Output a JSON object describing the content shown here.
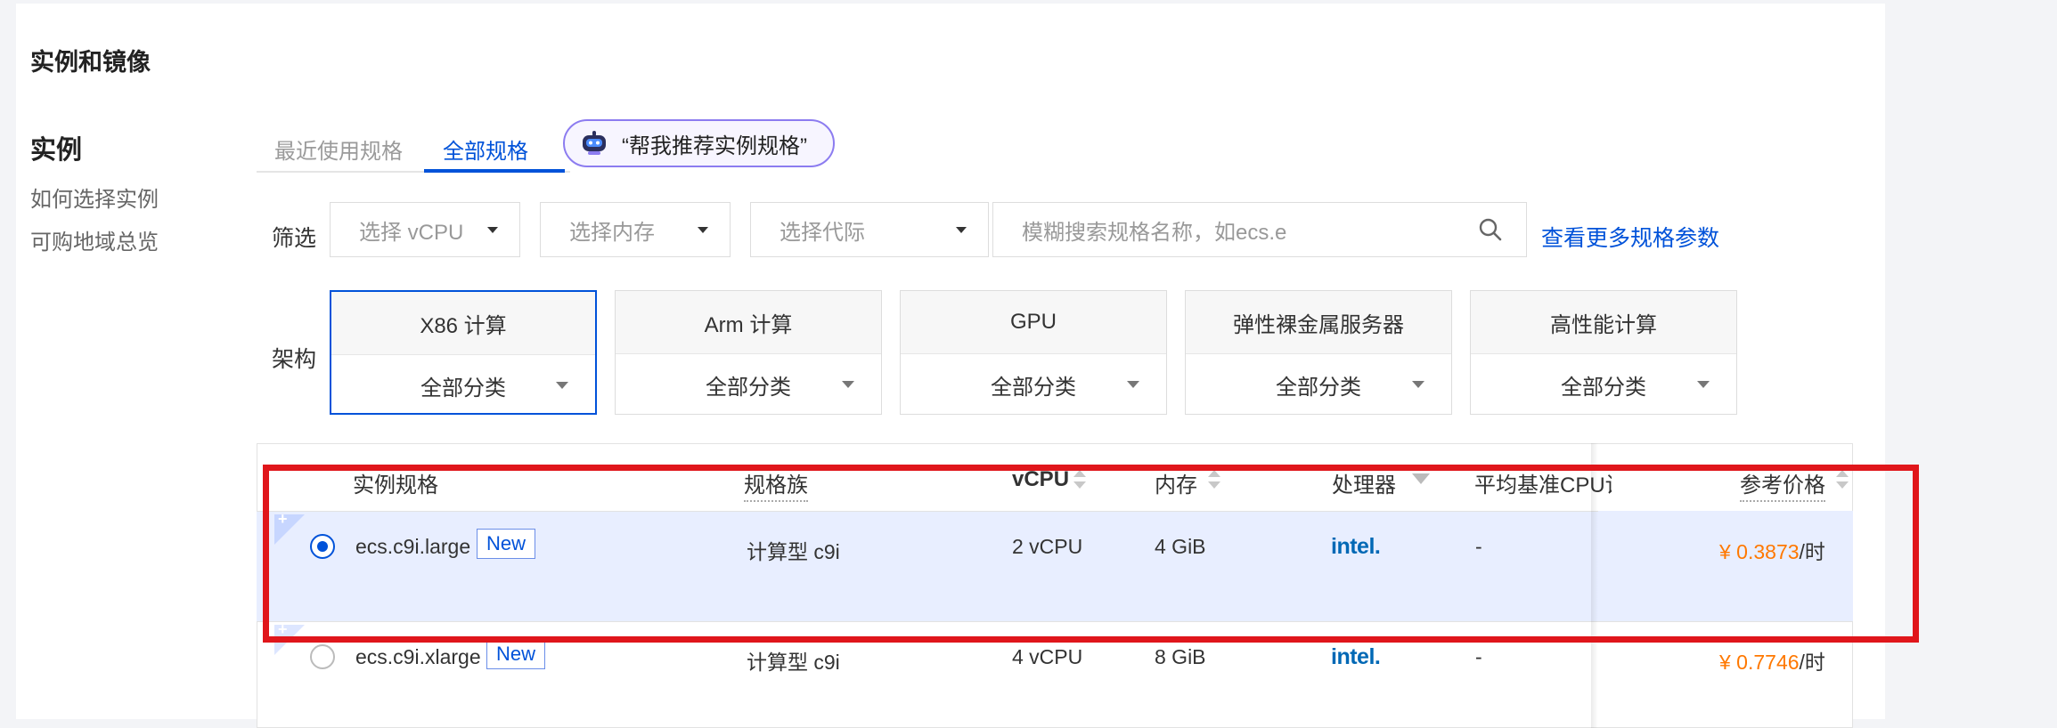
{
  "section_title": "实例和镜像",
  "sidebar": {
    "title": "实例",
    "links": [
      "如何选择实例",
      "可购地域总览"
    ]
  },
  "tabs": [
    {
      "label": "最近使用规格",
      "active": false
    },
    {
      "label": "全部规格",
      "active": true
    }
  ],
  "ai_button": {
    "label": "“帮我推荐实例规格”",
    "icon": "robot-icon"
  },
  "filter": {
    "label": "筛选",
    "selects": [
      "选择 vCPU",
      "选择内存",
      "选择代际"
    ],
    "search_placeholder": "模糊搜索规格名称，如ecs.e",
    "more_link": "查看更多规格参数"
  },
  "architecture": {
    "label": "架构",
    "cards": [
      {
        "title": "X86 计算",
        "sub": "全部分类",
        "active": true
      },
      {
        "title": "Arm 计算",
        "sub": "全部分类",
        "active": false
      },
      {
        "title": "GPU",
        "sub": "全部分类",
        "active": false
      },
      {
        "title": "弹性裸金属服务器",
        "sub": "全部分类",
        "active": false
      },
      {
        "title": "高性能计算",
        "sub": "全部分类",
        "active": false
      }
    ]
  },
  "table": {
    "headers": {
      "spec": "实例规格",
      "family": "规格族",
      "vcpu": "vCPU",
      "memory": "内存",
      "processor": "处理器",
      "baseline": "平均基准CPU计",
      "price": "参考价格"
    },
    "rows": [
      {
        "name": "ecs.c9i.large",
        "badge": "New",
        "family": "计算型 c9i",
        "vcpu": "2 vCPU",
        "memory": "4 GiB",
        "processor": "intel.",
        "baseline": "-",
        "price": "¥ 0.3873",
        "unit": "/时",
        "selected": true
      },
      {
        "name": "ecs.c9i.xlarge",
        "badge": "New",
        "family": "计算型 c9i",
        "vcpu": "4 vCPU",
        "memory": "8 GiB",
        "processor": "intel.",
        "baseline": "-",
        "price": "¥ 0.7746",
        "unit": "/时",
        "selected": false
      }
    ]
  },
  "colors": {
    "accent": "#0052d9",
    "price": "#ff7800",
    "highlight": "#e0161b",
    "selected_row": "#e8eeff"
  }
}
